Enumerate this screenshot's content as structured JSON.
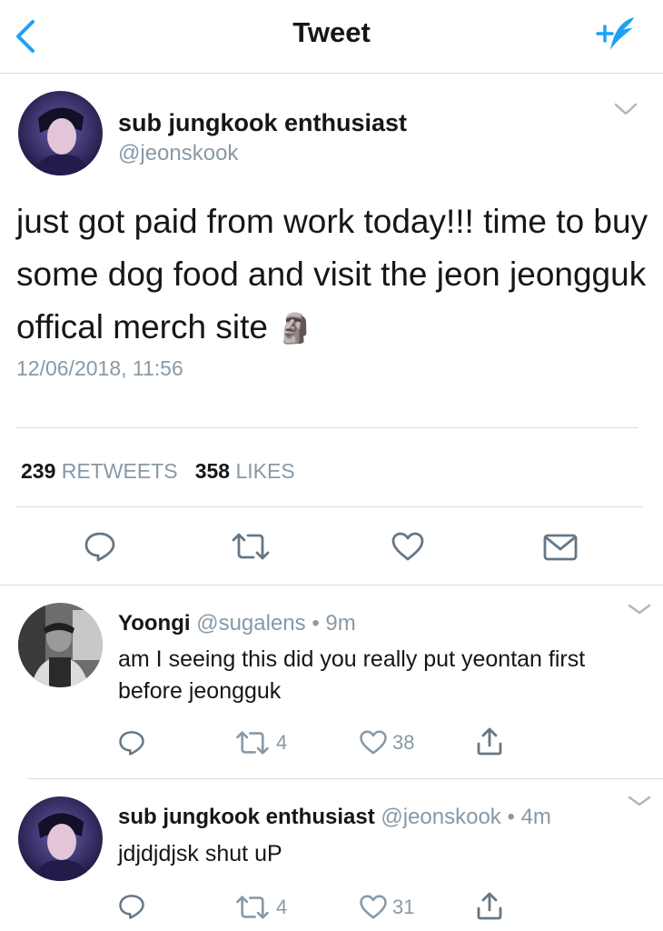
{
  "nav": {
    "title": "Tweet"
  },
  "main": {
    "author_name": "sub jungkook enthusiast",
    "author_handle": "@jeonskook",
    "text": "just got paid from work today!!! time to buy some dog food and visit the jeon jeongguk offical merch site",
    "emoji": "🗿",
    "timestamp": "12/06/2018, 11:56",
    "retweets_count": "239",
    "retweets_label": "RETWEETS",
    "likes_count": "358",
    "likes_label": "LIKES"
  },
  "replies": [
    {
      "name": "Yoongi",
      "handle": "@sugalens",
      "dot": "•",
      "time": "9m",
      "text": "am I seeing this did you really put yeontan first before jeongguk",
      "retweets": "4",
      "likes": "38"
    },
    {
      "name": "sub jungkook enthusiast",
      "handle": "@jeonskook",
      "dot": "•",
      "time": "4m",
      "text": "jdjdjdjsk shut uP",
      "retweets": "4",
      "likes": "31"
    }
  ],
  "colors": {
    "accent": "#1da1f2",
    "muted": "#8899a6",
    "text": "#14171a",
    "divider": "#d8dde1"
  },
  "icons": [
    "back-chevron-icon",
    "compose-icon",
    "dropdown-chevron-icon",
    "reply-icon",
    "retweet-icon",
    "like-icon",
    "message-icon",
    "share-icon"
  ]
}
